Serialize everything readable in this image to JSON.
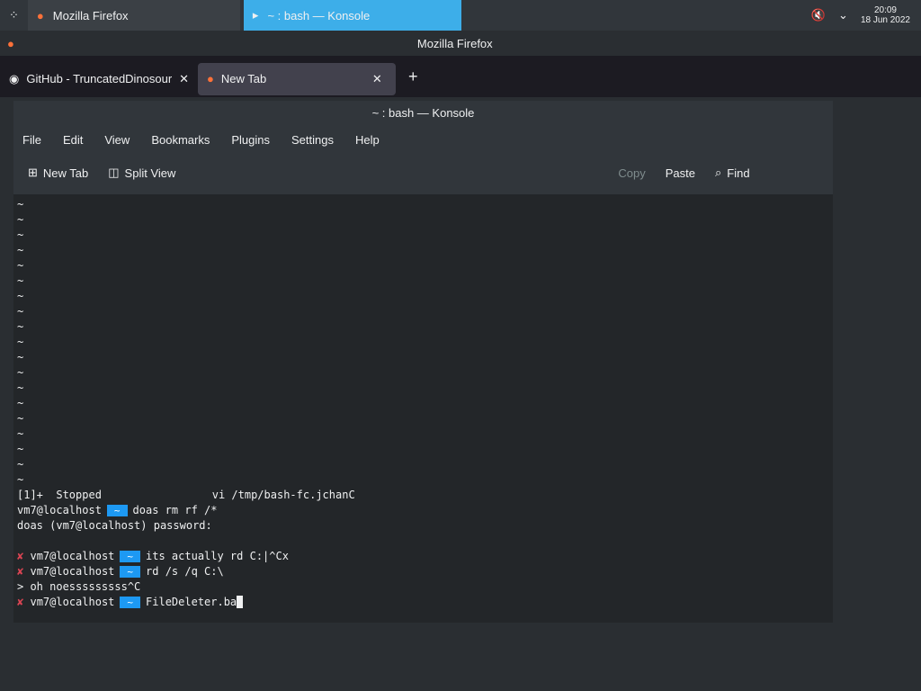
{
  "taskbar": {
    "tasks": [
      "Mozilla Firefox",
      "~ : bash — Konsole"
    ],
    "time": "20:09",
    "date": "18 Jun 2022"
  },
  "firefox": {
    "title": "Mozilla Firefox",
    "tabs": [
      "GitHub - TruncatedDinosour",
      "New Tab"
    ]
  },
  "konsole": {
    "title": "~ : bash — Konsole",
    "menu": [
      "File",
      "Edit",
      "View",
      "Bookmarks",
      "Plugins",
      "Settings",
      "Help"
    ],
    "toolbar": {
      "new_tab": "New Tab",
      "split_view": "Split View",
      "copy": "Copy",
      "paste": "Paste",
      "find": "Find"
    }
  },
  "terminal": {
    "tilde": "~",
    "stopped": "[1]+  Stopped                 vi /tmp/bash-fc.jchanC",
    "host": "vm7@localhost",
    "arrow": "~",
    "cmd1": "doas rm rf /*",
    "pw": "doas (vm7@localhost) password:",
    "cmd2": "its actually rd C:|^Cx",
    "cmd3": "rd /s /q C:\\",
    "cont": "> oh noesssssssss^C",
    "cmd4": "FileDeleter.ba",
    "mark": "✘"
  }
}
